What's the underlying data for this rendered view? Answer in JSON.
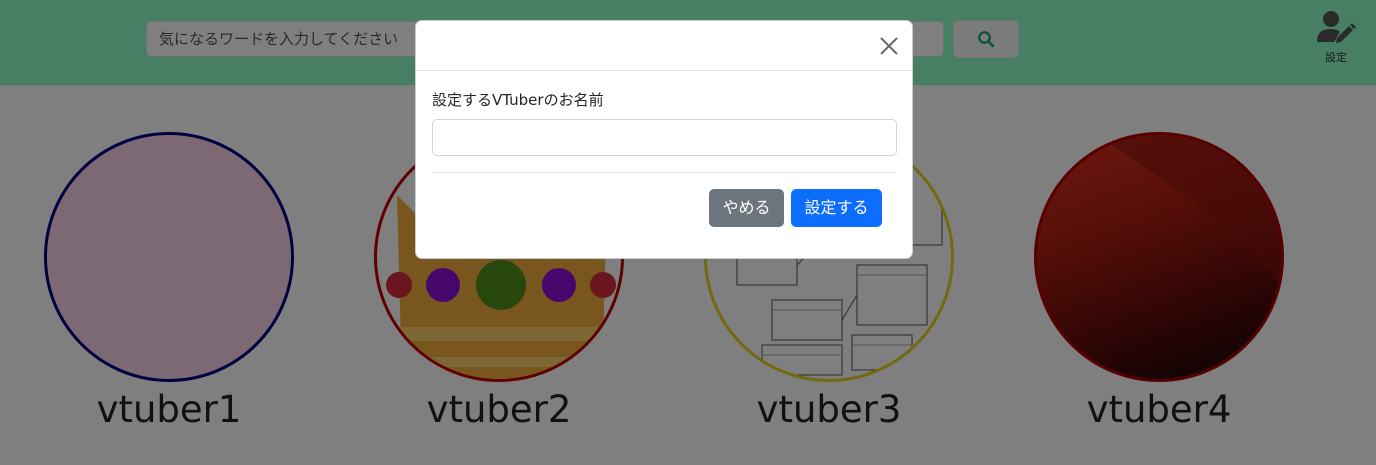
{
  "header": {
    "search_placeholder": "気になるワードを入力してください",
    "search_icon": "search-icon",
    "settings_icon": "user-edit-icon",
    "settings_label": "設定"
  },
  "vtubers": [
    {
      "name": "vtuber1",
      "border_color": "#000080"
    },
    {
      "name": "vtuber2",
      "border_color": "#c00000"
    },
    {
      "name": "vtuber3",
      "border_color": "#e6d21e"
    },
    {
      "name": "vtuber4",
      "border_color": "#b00000"
    }
  ],
  "modal": {
    "label": "設定するVTuberのお名前",
    "input_value": "",
    "cancel_label": "やめる",
    "ok_label": "設定する",
    "close_icon": "close-icon"
  },
  "colors": {
    "header_bg": "#8effcb",
    "primary": "#0d6efd",
    "secondary": "#6c757d"
  }
}
